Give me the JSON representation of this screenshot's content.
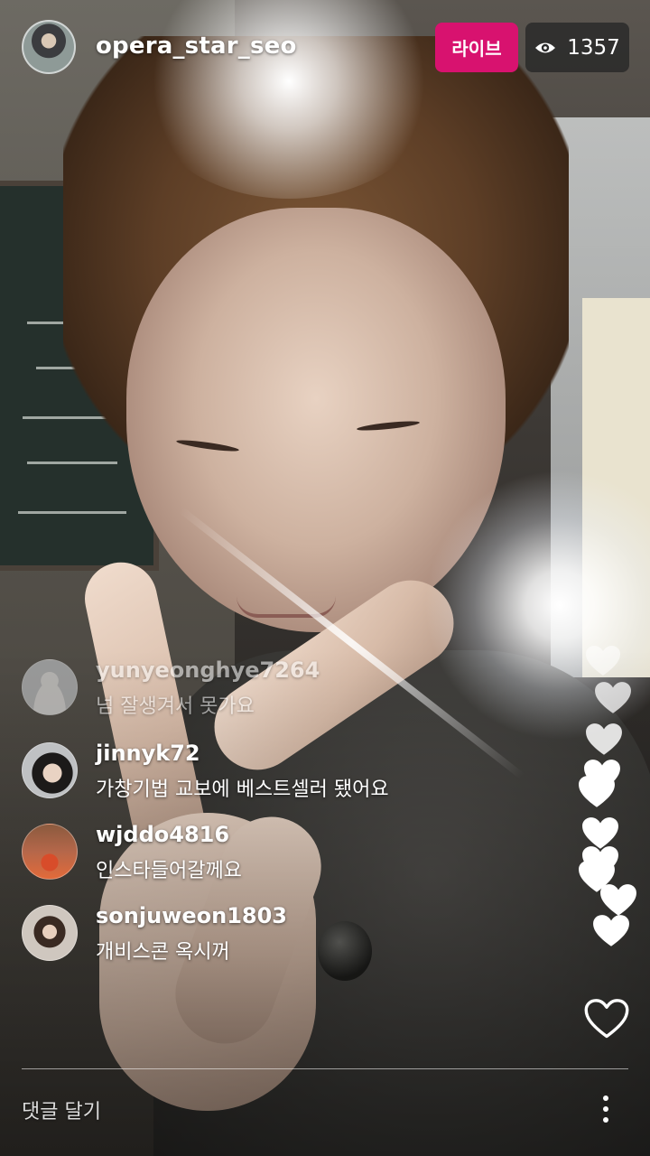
{
  "header": {
    "host_username": "opera_star_seo",
    "live_label": "라이브",
    "viewer_icon": "eye-icon",
    "viewer_count": "1357"
  },
  "comments": [
    {
      "username": "yunyeonghye7264",
      "text": "넘 잘생겨서 못가요",
      "faded": true
    },
    {
      "username": "jinnyk72",
      "text": "가창기법 교보에 베스트셀러 됐어요",
      "faded": false
    },
    {
      "username": "wjddo4816",
      "text": "인스타들어갈께요",
      "faded": false
    },
    {
      "username": "sonjuweon1803",
      "text": "개비스콘 옥시꺼",
      "faded": false
    }
  ],
  "footer": {
    "comment_placeholder": "댓글 달기",
    "like_icon": "heart-outline-icon",
    "more_icon": "more-vertical-icon"
  },
  "colors": {
    "live_badge": "#d8126f",
    "viewer_badge": "#282828",
    "text": "#ffffff"
  }
}
